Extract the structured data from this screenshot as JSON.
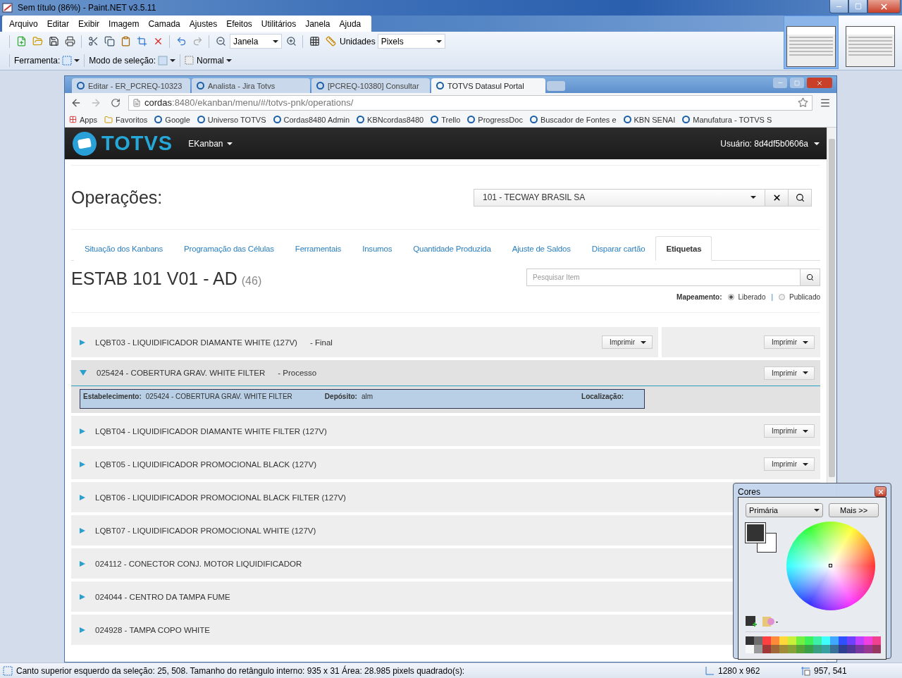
{
  "window": {
    "title": "Sem título (86%) - Paint.NET v3.5.11"
  },
  "menu": [
    "Arquivo",
    "Editar",
    "Exibir",
    "Imagem",
    "Camada",
    "Ajustes",
    "Efeitos",
    "Utilitários",
    "Janela",
    "Ajuda"
  ],
  "toolbar": {
    "zoom": "Janela",
    "units_label": "Unidades",
    "units": "Pixels"
  },
  "toolbar2": {
    "tool_label": "Ferramenta:",
    "mode_label": "Modo de seleção:",
    "blend": "Normal"
  },
  "thumbnails": [
    {
      "selected": true
    },
    {
      "selected": false
    }
  ],
  "browser": {
    "tabs": [
      {
        "title": "Editar - ER_PCREQ-10323",
        "selected": false
      },
      {
        "title": "Analista - Jira Totvs",
        "selected": false
      },
      {
        "title": "[PCREQ-10380] Consultar",
        "selected": false
      },
      {
        "title": "TOTVS Datasul Portal",
        "selected": true
      }
    ],
    "address_host": "cordas",
    "address_rest": ":8480/ekanban/menu/#/totvs-pnk/operations/",
    "bookmarks": [
      "Apps",
      "Favoritos",
      "Google",
      "Universo TOTVS",
      "Cordas8480 Admin",
      "KBNcordas8480",
      "Trello",
      "ProgressDoc",
      "Buscador de Fontes e",
      "KBN SENAI",
      "Manufatura - TOTVS S"
    ]
  },
  "navbar": {
    "logo": "TOTVS",
    "menu": "EKanban",
    "user": "Usuário: 8d4df5b0606a"
  },
  "page": {
    "title": "Operações:",
    "company": "101 - TECWAY BRASIL SA",
    "tabs": [
      {
        "label": "Situação dos Kanbans",
        "selected": false
      },
      {
        "label": "Programação das Células",
        "selected": false
      },
      {
        "label": "Ferramentais",
        "selected": false
      },
      {
        "label": "Insumos",
        "selected": false
      },
      {
        "label": "Quantidade Produzida",
        "selected": false
      },
      {
        "label": "Ajuste de Saldos",
        "selected": false
      },
      {
        "label": "Disparar cartão",
        "selected": false
      },
      {
        "label": "Etiquetas",
        "selected": true
      }
    ],
    "heading": "ESTAB 101 V01 - AD",
    "count": "(46)",
    "search_placeholder": "Pesquisar Item",
    "mapping_label": "Mapeamento:",
    "mapping_separator": "|",
    "mapping": [
      {
        "label": "Liberado",
        "selected": true
      },
      {
        "label": "Publicado",
        "selected": false
      }
    ],
    "rows": [
      {
        "name": "LQBT03 - LIQUIDIFICADOR DIAMANTE WHITE (127V)",
        "suffix": "- Final",
        "expanded": false,
        "buttons": [
          "Imprimir",
          "Imprimir"
        ]
      },
      {
        "name": "025424 - COBERTURA GRAV. WHITE FILTER",
        "suffix": "- Processo",
        "expanded": true,
        "buttons": [
          "Imprimir"
        ],
        "detail": {
          "est_label": "Estabelecimento:",
          "est": "025424 - COBERTURA GRAV. WHITE FILTER",
          "dep_label": "Depósito:",
          "dep": "alm",
          "loc_label": "Localização:"
        }
      },
      {
        "name": "LQBT04 - LIQUIDIFICADOR DIAMANTE WHITE FILTER (127V)",
        "expanded": false,
        "buttons": [
          "Imprimir"
        ]
      },
      {
        "name": "LQBT05 - LIQUIDIFICADOR PROMOCIONAL BLACK (127V)",
        "expanded": false,
        "buttons": [
          "Imprimir"
        ]
      },
      {
        "name": "LQBT06 - LIQUIDIFICADOR PROMOCIONAL BLACK FILTER (127V)",
        "expanded": false
      },
      {
        "name": "LQBT07 - LIQUIDIFICADOR PROMOCIONAL WHITE (127V)",
        "expanded": false
      },
      {
        "name": "024112 - CONECTOR CONJ. MOTOR LIQUIDIFICADOR",
        "expanded": false
      },
      {
        "name": "024044 - CENTRO DA TAMPA FUME",
        "expanded": false
      },
      {
        "name": "024928 - TAMPA COPO WHITE",
        "expanded": false
      }
    ]
  },
  "colors_window": {
    "title": "Cores",
    "mode": "Primária",
    "more": "Mais >>",
    "palette": [
      {
        "color": "#333333"
      },
      {
        "color": "#6e6e6e"
      },
      {
        "color": "#ff4040"
      },
      {
        "color": "#ff8a3a"
      },
      {
        "color": "#ffd83a"
      },
      {
        "color": "#c8f03a"
      },
      {
        "color": "#70f040"
      },
      {
        "color": "#3cf05a"
      },
      {
        "color": "#3cf0a8"
      },
      {
        "color": "#40ffff"
      },
      {
        "color": "#40a8ff"
      },
      {
        "color": "#3050ff"
      },
      {
        "color": "#7040ff"
      },
      {
        "color": "#c040ff"
      },
      {
        "color": "#f040e0"
      },
      {
        "color": "#f04090"
      },
      {
        "color": "#f8f8f8"
      },
      {
        "color": "#9a9a9a"
      },
      {
        "color": "#a03838"
      },
      {
        "color": "#a06838"
      },
      {
        "color": "#a08c38"
      },
      {
        "color": "#88a038"
      },
      {
        "color": "#58a038"
      },
      {
        "color": "#38a048"
      },
      {
        "color": "#38a080"
      },
      {
        "color": "#38a0a0"
      },
      {
        "color": "#387098"
      },
      {
        "color": "#304090"
      },
      {
        "color": "#503898"
      },
      {
        "color": "#7838a0"
      },
      {
        "color": "#983890"
      },
      {
        "color": "#983860"
      }
    ]
  },
  "status_bar": {
    "text": "Canto superior esquerdo da seleção: 25, 508. Tamanho do retângulo interno: 935 x 31 Área: 28.985 pixels quadrado(s):",
    "size": "1280 x 962",
    "cursor": "957, 541"
  }
}
